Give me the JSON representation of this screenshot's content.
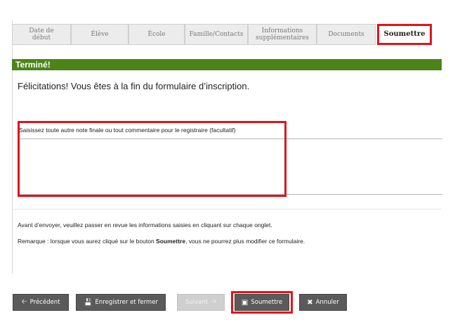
{
  "tabs": [
    {
      "label_line1": "Date de",
      "label_line2": "début"
    },
    {
      "label_line1": "Élève",
      "label_line2": ""
    },
    {
      "label_line1": "École",
      "label_line2": ""
    },
    {
      "label_line1": "Famille/Contacts",
      "label_line2": ""
    },
    {
      "label_line1": "Informations",
      "label_line2": "supplémentaires"
    },
    {
      "label_line1": "Documents",
      "label_line2": ""
    },
    {
      "label_line1": "Soumettre",
      "label_line2": ""
    }
  ],
  "banner": {
    "title": "Terminé!"
  },
  "content": {
    "congrats": "Félicitations! Vous êtes à la fin du formulaire d’inscription.",
    "note_label": "Saisissez toute autre note finale ou tout commentaire pour le registraire (facultatif)",
    "note_value": "",
    "info_review": "Avant d’envoyer, veuillez passer en revue les informations saisies en cliquant sur chaque onglet.",
    "info_remark_before": "Remarque : lorsque vous aurez cliqué sur le bouton ",
    "info_remark_bold": "Soumettre",
    "info_remark_after": ", vous ne pourrez plus modifier ce formulaire."
  },
  "buttons": {
    "previous": "Précédent",
    "save_close": "Enregistrer et fermer",
    "next": "Suivant",
    "submit": "Soumettre",
    "cancel": "Annuler"
  },
  "colors": {
    "accent_green": "#4d8418",
    "highlight_red": "#e0141c",
    "button_gray": "#5a5a5a"
  }
}
